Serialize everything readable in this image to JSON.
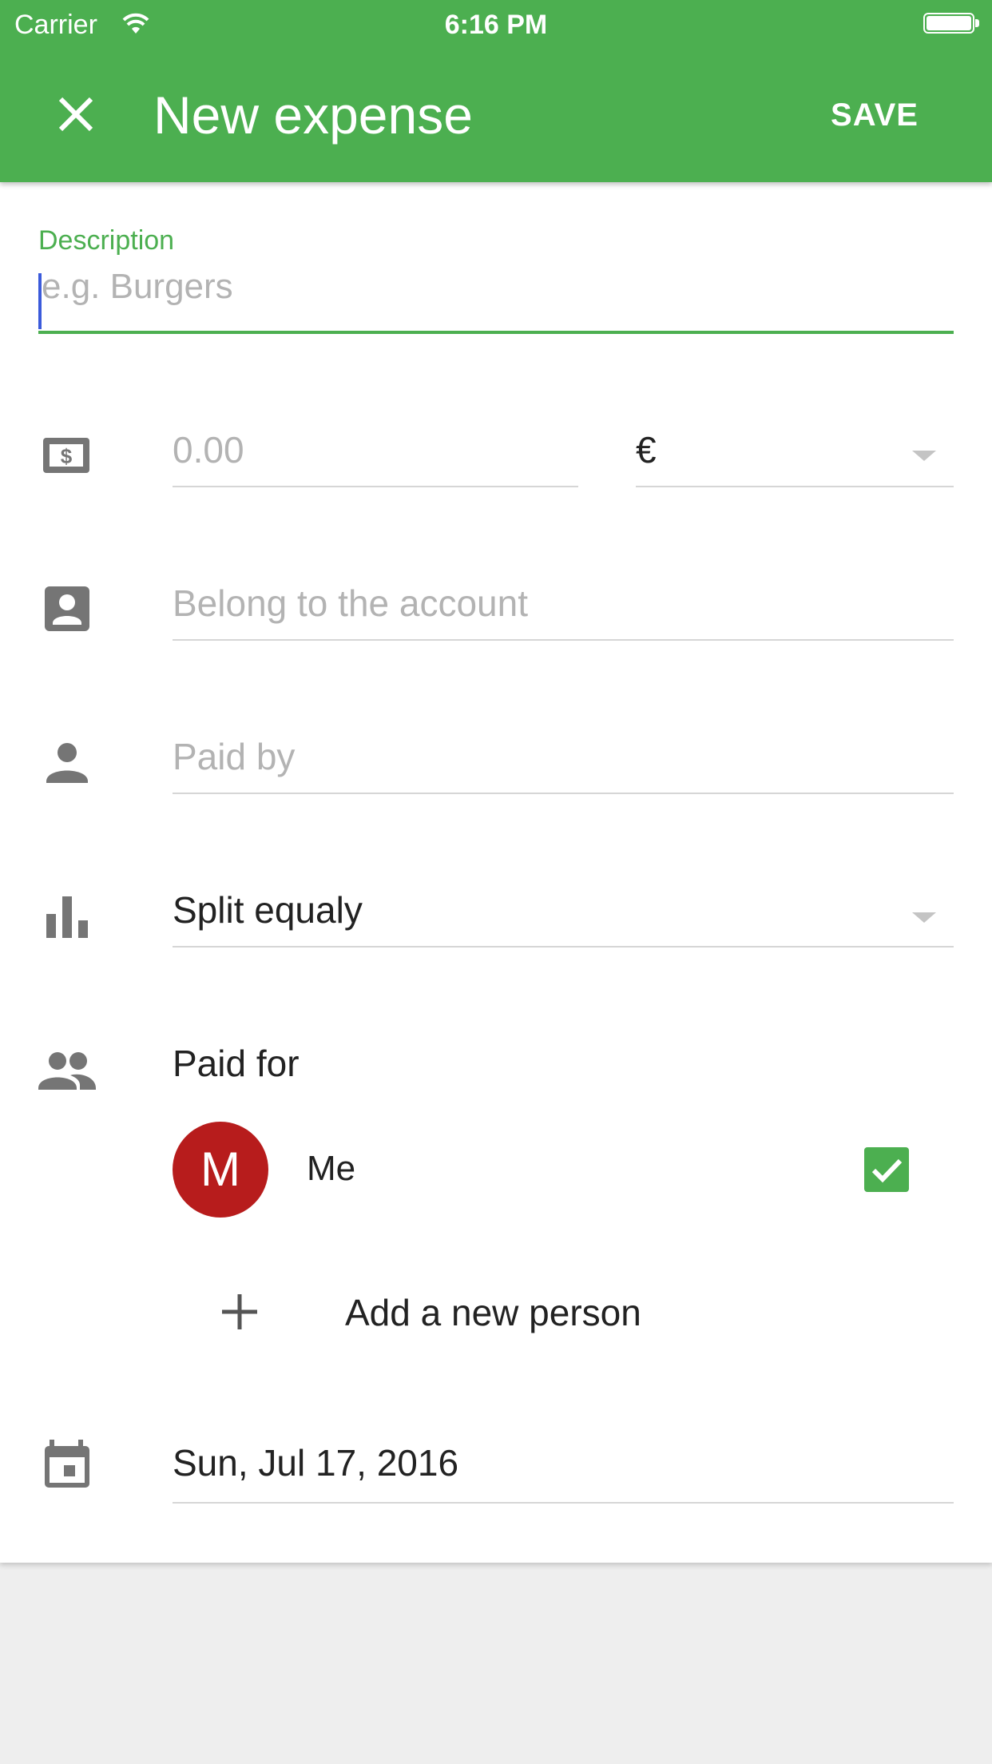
{
  "status_bar": {
    "carrier": "Carrier",
    "time": "6:16 PM"
  },
  "app_bar": {
    "title": "New expense",
    "save_label": "SAVE",
    "close_icon": "close-icon",
    "color": "#4caf50"
  },
  "form": {
    "description": {
      "label": "Description",
      "placeholder": "e.g. Burgers",
      "value": ""
    },
    "amount": {
      "icon": "money-icon",
      "placeholder": "0.00",
      "currency": "€"
    },
    "account": {
      "icon": "account-box-icon",
      "placeholder": "Belong to the account"
    },
    "paid_by": {
      "icon": "person-icon",
      "placeholder": "Paid by"
    },
    "split": {
      "icon": "bar-chart-icon",
      "value": "Split equaly"
    },
    "paid_for": {
      "icon": "group-icon",
      "label": "Paid for",
      "people": [
        {
          "initial": "M",
          "name": "Me",
          "checked": true,
          "avatar_color": "#b71c1c"
        }
      ],
      "add_person_label": "Add a new person"
    },
    "date": {
      "icon": "calendar-icon",
      "value": "Sun, Jul 17, 2016"
    }
  }
}
